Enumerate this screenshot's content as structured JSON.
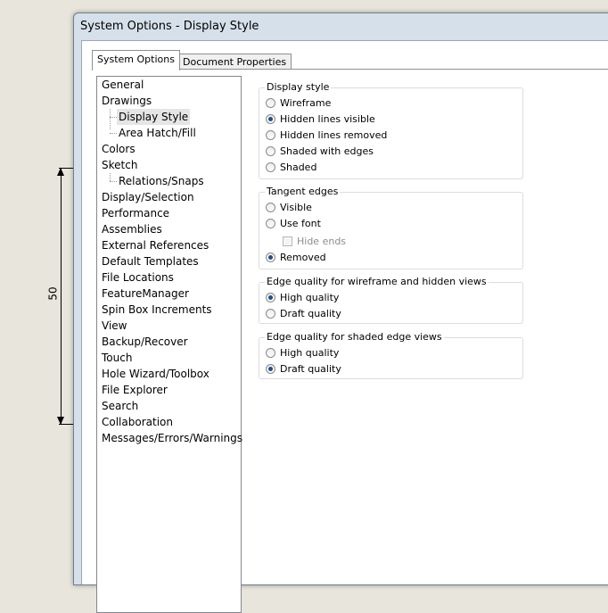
{
  "window": {
    "title": "System Options - Display Style"
  },
  "tabs": [
    {
      "label": "System Options",
      "active": true
    },
    {
      "label": "Document Properties",
      "active": false
    }
  ],
  "tree": {
    "items": [
      {
        "label": "General",
        "indent": 0
      },
      {
        "label": "Drawings",
        "indent": 0
      },
      {
        "label": "Display Style",
        "indent": 1,
        "selected": true
      },
      {
        "label": "Area Hatch/Fill",
        "indent": 1
      },
      {
        "label": "Colors",
        "indent": 0
      },
      {
        "label": "Sketch",
        "indent": 0
      },
      {
        "label": "Relations/Snaps",
        "indent": 1
      },
      {
        "label": "Display/Selection",
        "indent": 0
      },
      {
        "label": "Performance",
        "indent": 0
      },
      {
        "label": "Assemblies",
        "indent": 0
      },
      {
        "label": "External References",
        "indent": 0
      },
      {
        "label": "Default Templates",
        "indent": 0
      },
      {
        "label": "File Locations",
        "indent": 0
      },
      {
        "label": "FeatureManager",
        "indent": 0
      },
      {
        "label": "Spin Box Increments",
        "indent": 0
      },
      {
        "label": "View",
        "indent": 0
      },
      {
        "label": "Backup/Recover",
        "indent": 0
      },
      {
        "label": "Touch",
        "indent": 0
      },
      {
        "label": "Hole Wizard/Toolbox",
        "indent": 0
      },
      {
        "label": "File Explorer",
        "indent": 0
      },
      {
        "label": "Search",
        "indent": 0
      },
      {
        "label": "Collaboration",
        "indent": 0
      },
      {
        "label": "Messages/Errors/Warnings",
        "indent": 0
      }
    ]
  },
  "display_style": {
    "title": "Display style",
    "options": [
      "Wireframe",
      "Hidden lines visible",
      "Hidden lines removed",
      "Shaded with edges",
      "Shaded"
    ],
    "selected": "Hidden lines visible"
  },
  "tangent_edges": {
    "title": "Tangent edges",
    "visible_label": "Visible",
    "use_font_label": "Use font",
    "hide_ends_label": "Hide ends",
    "removed_label": "Removed",
    "selected": "Removed"
  },
  "edge_quality_wireframe": {
    "title": "Edge quality for wireframe and hidden views",
    "options": [
      "High quality",
      "Draft quality"
    ],
    "selected": "High quality"
  },
  "edge_quality_shaded": {
    "title": "Edge quality for shaded edge views",
    "options": [
      "High quality",
      "Draft quality"
    ],
    "selected": "Draft quality"
  },
  "background_drawing": {
    "dimension_value": "50"
  }
}
